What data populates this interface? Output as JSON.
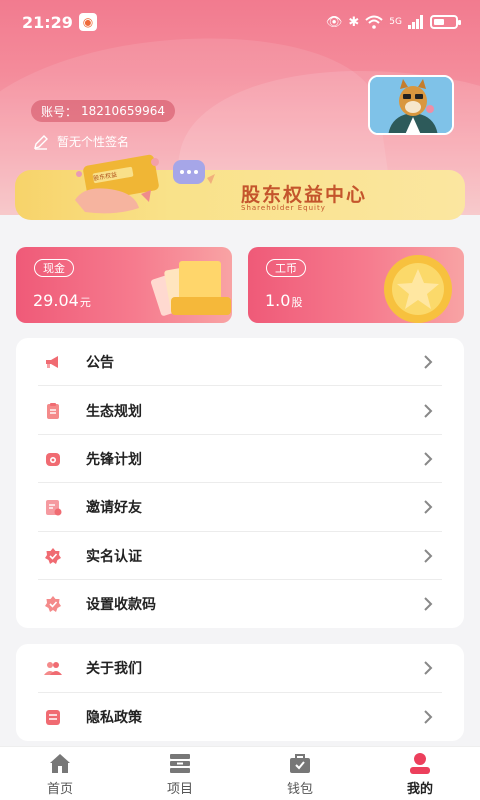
{
  "status_bar": {
    "time": "21:29",
    "network": "5G"
  },
  "profile": {
    "account_label": "账号：",
    "account_number": "18210659964",
    "signature": "暂无个性签名",
    "avatar_icon": "shiba-dog-avatar"
  },
  "banner": {
    "title": "股东权益中心",
    "subtitle": "Shareholder Equity",
    "card_text": "股东权益"
  },
  "cards": {
    "cash": {
      "label": "现金",
      "value": "29.04",
      "unit": "元"
    },
    "gongbi": {
      "label": "工币",
      "value": "1.0",
      "unit": "股"
    }
  },
  "menu_main": [
    {
      "label": "公告",
      "icon": "megaphone-icon"
    },
    {
      "label": "生态规划",
      "icon": "clipboard-icon"
    },
    {
      "label": "先锋计划",
      "icon": "plan-icon"
    },
    {
      "label": "邀请好友",
      "icon": "invite-icon"
    },
    {
      "label": "实名认证",
      "icon": "verify-icon"
    },
    {
      "label": "设置收款码",
      "icon": "qrcode-icon"
    }
  ],
  "menu_about": [
    {
      "label": "关于我们",
      "icon": "group-icon"
    },
    {
      "label": "隐私政策",
      "icon": "document-icon"
    }
  ],
  "tabs": [
    {
      "label": "首页",
      "icon": "home-icon"
    },
    {
      "label": "项目",
      "icon": "stack-icon"
    },
    {
      "label": "钱包",
      "icon": "wallet-icon"
    },
    {
      "label": "我的",
      "icon": "user-icon"
    }
  ],
  "colors": {
    "accent": "#ef5a78",
    "banner_text": "#c4552c",
    "icon_red": "#f06b72"
  }
}
